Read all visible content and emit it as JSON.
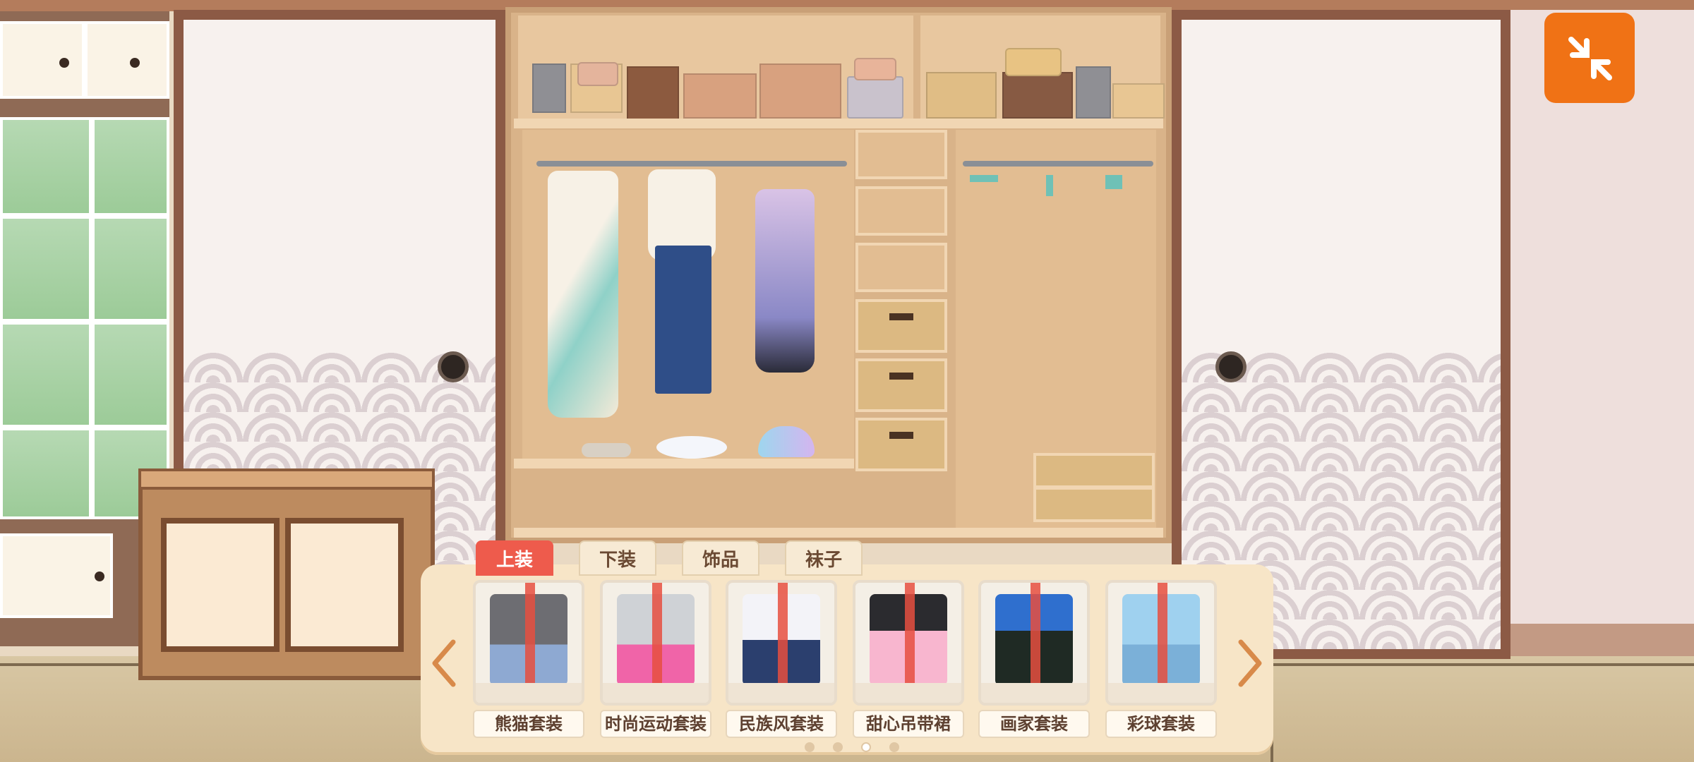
{
  "tabs": [
    {
      "label": "上装",
      "active": true
    },
    {
      "label": "下装",
      "active": false
    },
    {
      "label": "饰品",
      "active": false
    },
    {
      "label": "袜子",
      "active": false
    }
  ],
  "items": [
    {
      "name": "熊猫套装",
      "icon": "panda-outfit-icon"
    },
    {
      "name": "时尚运动套装",
      "icon": "sport-outfit-icon"
    },
    {
      "name": "民族风套装",
      "icon": "ethnic-outfit-icon"
    },
    {
      "name": "甜心吊带裙",
      "icon": "sweetheart-dress-icon"
    },
    {
      "name": "画家套装",
      "icon": "painter-outfit-icon"
    },
    {
      "name": "彩球套装",
      "icon": "ball-outfit-icon"
    }
  ],
  "pagination": {
    "total": 4,
    "current": 3
  },
  "colors": {
    "accent": "#f07215",
    "tab_active": "#ee5b4c",
    "ribbon": "#e64f40"
  }
}
